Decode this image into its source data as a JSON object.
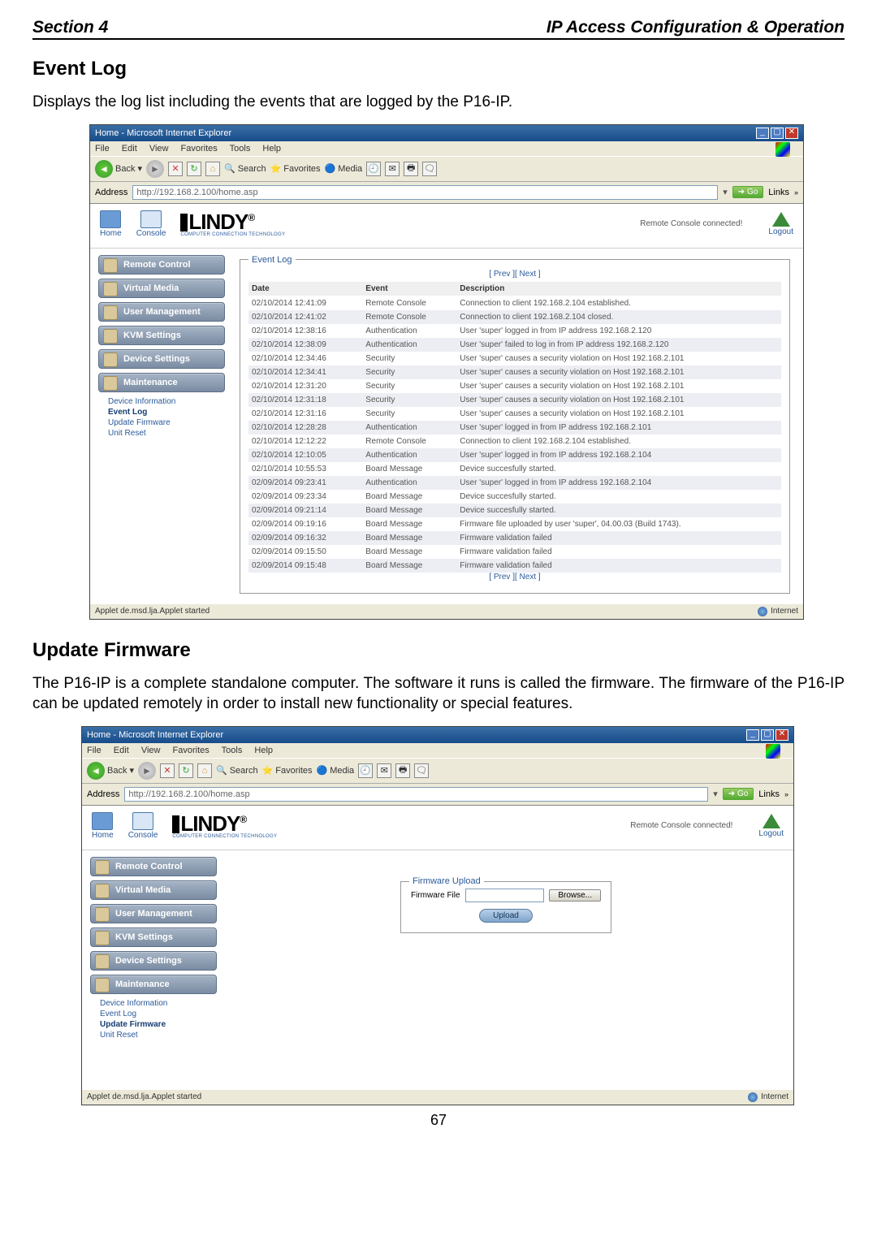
{
  "header": {
    "left": "Section 4",
    "right": "IP Access Configuration & Operation"
  },
  "section1_title": "Event Log",
  "section1_desc": "Displays the log list including the events that are logged by the P16-IP.",
  "section2_title": "Update Firmware",
  "section2_desc": "The P16-IP is a complete standalone computer. The software it runs is called the firmware. The firmware of the P16-IP can be updated remotely in order to install new functionality or special features.",
  "page_number": "67",
  "ie": {
    "title": "Home - Microsoft Internet Explorer",
    "menu": [
      "File",
      "Edit",
      "View",
      "Favorites",
      "Tools",
      "Help"
    ],
    "back": "Back",
    "toolbar": [
      "Search",
      "Favorites",
      "Media"
    ],
    "addr_label": "Address",
    "addr_value": "http://192.168.2.100/home.asp",
    "go": "Go",
    "links": "Links",
    "status_applet": "Applet de.msd.lja.Applet started",
    "status_net": "Internet"
  },
  "app": {
    "brand": "LINDY",
    "brand_sub": "COMPUTER CONNECTION TECHNOLOGY",
    "home": "Home",
    "console": "Console",
    "logout": "Logout",
    "status": "Remote Console connected!",
    "nav": [
      "Remote Control",
      "Virtual Media",
      "User Management",
      "KVM Settings",
      "Device Settings",
      "Maintenance"
    ],
    "maint_sub": [
      "Device Information",
      "Event Log",
      "Update Firmware",
      "Unit Reset"
    ]
  },
  "eventlog": {
    "legend": "Event Log",
    "prevnext": "[ Prev ][ Next ]",
    "cols": [
      "Date",
      "Event",
      "Description"
    ],
    "rows": [
      [
        "02/10/2014 12:41:09",
        "Remote Console",
        "Connection to client 192.168.2.104 established."
      ],
      [
        "02/10/2014 12:41:02",
        "Remote Console",
        "Connection to client 192.168.2.104 closed."
      ],
      [
        "02/10/2014 12:38:16",
        "Authentication",
        "User 'super' logged in from IP address 192.168.2.120"
      ],
      [
        "02/10/2014 12:38:09",
        "Authentication",
        "User 'super' failed to log in from IP address 192.168.2.120"
      ],
      [
        "02/10/2014 12:34:46",
        "Security",
        "User 'super' causes a security violation on Host 192.168.2.101"
      ],
      [
        "02/10/2014 12:34:41",
        "Security",
        "User 'super' causes a security violation on Host 192.168.2.101"
      ],
      [
        "02/10/2014 12:31:20",
        "Security",
        "User 'super' causes a security violation on Host 192.168.2.101"
      ],
      [
        "02/10/2014 12:31:18",
        "Security",
        "User 'super' causes a security violation on Host 192.168.2.101"
      ],
      [
        "02/10/2014 12:31:16",
        "Security",
        "User 'super' causes a security violation on Host 192.168.2.101"
      ],
      [
        "02/10/2014 12:28:28",
        "Authentication",
        "User 'super' logged in from IP address 192.168.2.101"
      ],
      [
        "02/10/2014 12:12:22",
        "Remote Console",
        "Connection to client 192.168.2.104 established."
      ],
      [
        "02/10/2014 12:10:05",
        "Authentication",
        "User 'super' logged in from IP address 192.168.2.104"
      ],
      [
        "02/10/2014 10:55:53",
        "Board Message",
        "Device succesfully started."
      ],
      [
        "02/09/2014 09:23:41",
        "Authentication",
        "User 'super' logged in from IP address 192.168.2.104"
      ],
      [
        "02/09/2014 09:23:34",
        "Board Message",
        "Device succesfully started."
      ],
      [
        "02/09/2014 09:21:14",
        "Board Message",
        "Device succesfully started."
      ],
      [
        "02/09/2014 09:19:16",
        "Board Message",
        "Firmware file uploaded by user 'super', 04.00.03 (Build 1743)."
      ],
      [
        "02/09/2014 09:16:32",
        "Board Message",
        "Firmware validation failed"
      ],
      [
        "02/09/2014 09:15:50",
        "Board Message",
        "Firmware validation failed"
      ],
      [
        "02/09/2014 09:15:48",
        "Board Message",
        "Firmware validation failed"
      ]
    ]
  },
  "firmware": {
    "legend": "Firmware Upload",
    "label": "Firmware File",
    "browse": "Browse...",
    "upload": "Upload"
  }
}
